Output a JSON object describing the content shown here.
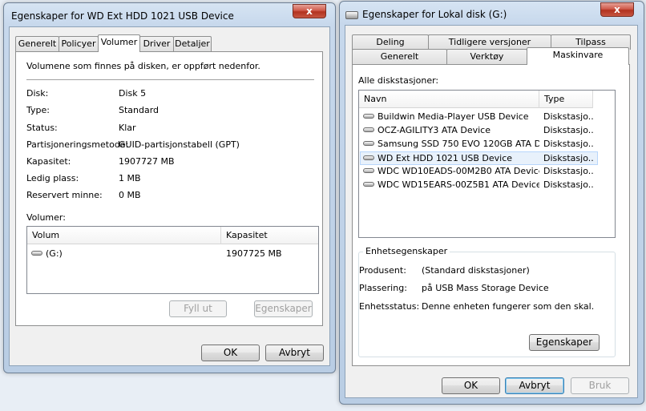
{
  "left": {
    "title": "Egenskaper for WD Ext HDD 1021 USB Device",
    "close": "x",
    "tabs": [
      "Generelt",
      "Policyer",
      "Volumer",
      "Driver",
      "Detaljer"
    ],
    "active_tab": "Volumer",
    "intro": "Volumene som finnes på disken, er oppført nedenfor.",
    "props": [
      {
        "label": "Disk:",
        "value": "Disk 5"
      },
      {
        "label": "Type:",
        "value": "Standard"
      },
      {
        "label": "Status:",
        "value": "Klar"
      },
      {
        "label": "Partisjoneringsmetode:",
        "value": "GUID-partisjonstabell (GPT)"
      },
      {
        "label": "Kapasitet:",
        "value": "1907727 MB"
      },
      {
        "label": "Ledig plass:",
        "value": "1 MB"
      },
      {
        "label": "Reservert minne:",
        "value": "0 MB"
      }
    ],
    "volumes_label": "Volumer:",
    "columns": [
      "Volum",
      "Kapasitet"
    ],
    "volumes": [
      {
        "name": "(G:)",
        "capacity": "1907725 MB"
      }
    ],
    "populate_button": "Fyll ut",
    "properties_button": "Egenskaper",
    "ok_button": "OK",
    "cancel_button": "Avbryt"
  },
  "right": {
    "title": "Egenskaper for Lokal disk (G:)",
    "close": "x",
    "tabs_back": [
      "Deling",
      "Tidligere versjoner",
      "Tilpass"
    ],
    "tabs_front": [
      "Generelt",
      "Verktøy",
      "Maskinvare"
    ],
    "active_tab": "Maskinvare",
    "all_drives_label": "Alle diskstasjoner:",
    "columns": [
      "Navn",
      "Type"
    ],
    "drives": [
      {
        "name": "Buildwin Media-Player USB Device",
        "type": "Diskstasjo..."
      },
      {
        "name": "OCZ-AGILITY3 ATA Device",
        "type": "Diskstasjo..."
      },
      {
        "name": "Samsung SSD 750 EVO 120GB ATA D...",
        "type": "Diskstasjo..."
      },
      {
        "name": "WD Ext HDD 1021 USB Device",
        "type": "Diskstasjo..."
      },
      {
        "name": "WDC WD10EADS-00M2B0 ATA Device",
        "type": "Diskstasjo..."
      },
      {
        "name": "WDC WD15EARS-00Z5B1 ATA Device",
        "type": "Diskstasjo..."
      }
    ],
    "selected_drive": "WD Ext HDD 1021 USB Device",
    "device_group_title": "Enhetsegenskaper",
    "device_props": [
      {
        "label": "Produsent:",
        "value": "(Standard diskstasjoner)"
      },
      {
        "label": "Plassering:",
        "value": "på USB Mass Storage Device"
      },
      {
        "label": "Enhetsstatus:",
        "value": "Denne enheten fungerer som den skal."
      }
    ],
    "properties_button": "Egenskaper",
    "ok_button": "OK",
    "cancel_button": "Avbryt",
    "apply_button": "Bruk"
  }
}
